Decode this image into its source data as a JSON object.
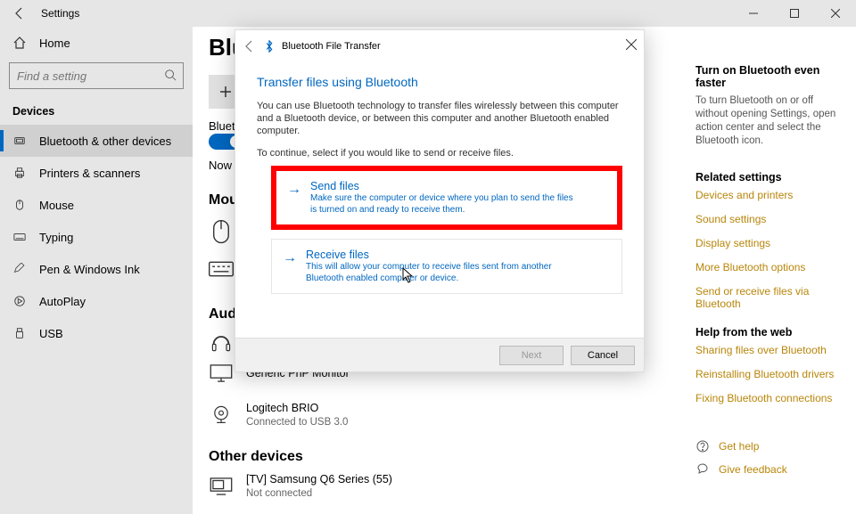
{
  "titlebar": {
    "title": "Settings"
  },
  "sidebar": {
    "home": "Home",
    "search_placeholder": "Find a setting",
    "group": "Devices",
    "items": [
      {
        "label": "Bluetooth & other devices"
      },
      {
        "label": "Printers & scanners"
      },
      {
        "label": "Mouse"
      },
      {
        "label": "Typing"
      },
      {
        "label": "Pen & Windows Ink"
      },
      {
        "label": "AutoPlay"
      },
      {
        "label": "USB"
      }
    ]
  },
  "main": {
    "page_title_partial": "Blu",
    "bluetooth_label_partial": "Bluet",
    "now_discoverable": "Now d",
    "mouse_h": "Mou",
    "audio_h": "Audi",
    "other_h": "Other devices",
    "generic_monitor": "Generic PnP Monitor",
    "cam_name": "Logitech BRIO",
    "cam_sub": "Connected to USB 3.0",
    "tv_name": "[TV] Samsung Q6 Series (55)",
    "tv_sub": "Not connected"
  },
  "right": {
    "h1": "Turn on Bluetooth even faster",
    "p1": "To turn Bluetooth on or off without opening Settings, open action center and select the Bluetooth icon.",
    "h2": "Related settings",
    "links_rel": [
      "Devices and printers",
      "Sound settings",
      "Display settings",
      "More Bluetooth options",
      "Send or receive files via Bluetooth"
    ],
    "h3": "Help from the web",
    "links_help": [
      "Sharing files over Bluetooth",
      "Reinstalling Bluetooth drivers",
      "Fixing Bluetooth connections"
    ],
    "get_help": "Get help",
    "feedback": "Give feedback"
  },
  "wizard": {
    "title": "Bluetooth File Transfer",
    "heading": "Transfer files using Bluetooth",
    "desc": "You can use Bluetooth technology to transfer files wirelessly between this computer and a Bluetooth device, or between this computer and another Bluetooth enabled computer.",
    "desc2": "To continue, select if you would like to send or receive files.",
    "send_title": "Send files",
    "send_desc": "Make sure the computer or device where you plan to send the files is turned on and ready to receive them.",
    "recv_title": "Receive files",
    "recv_desc": "This will allow your computer to receive files sent from another Bluetooth enabled computer or device.",
    "next": "Next",
    "cancel": "Cancel"
  }
}
